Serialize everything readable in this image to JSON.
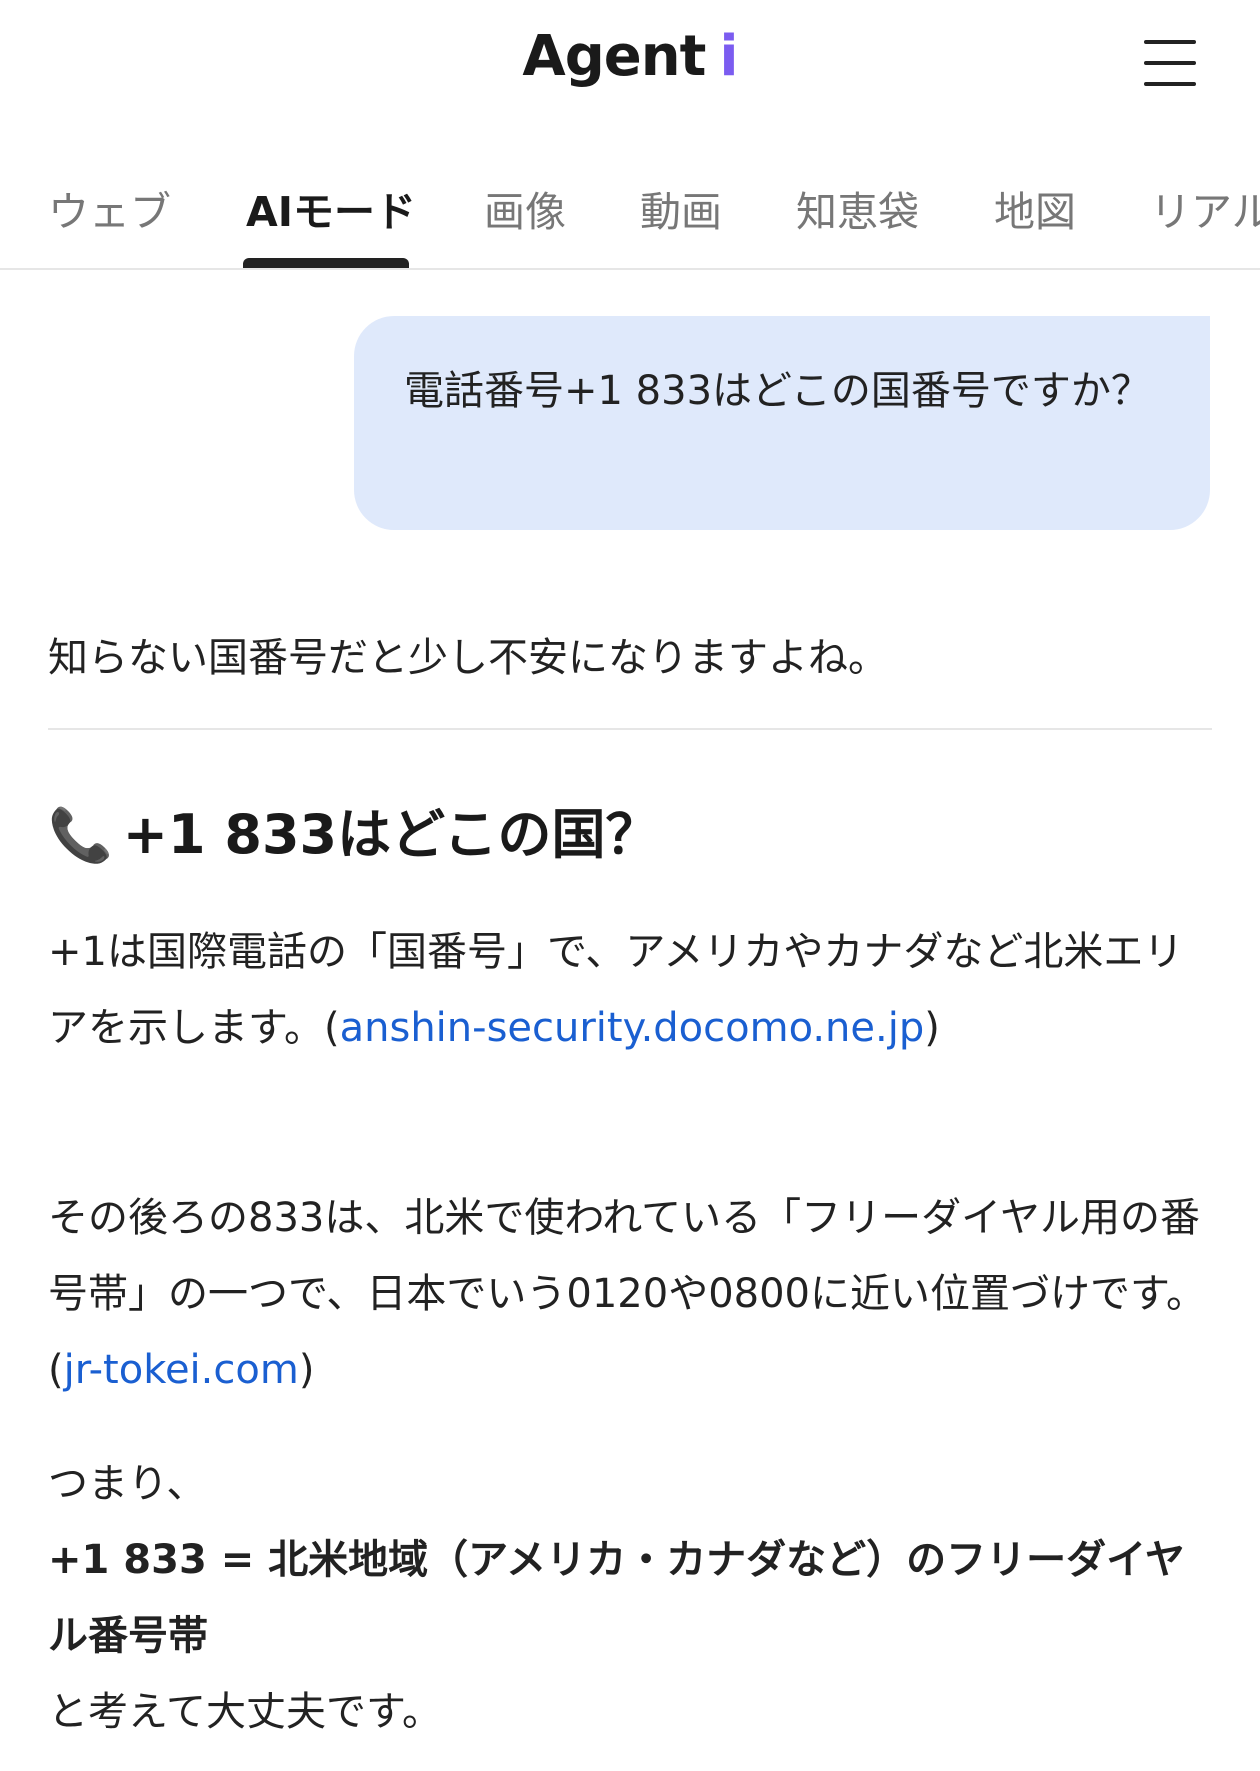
{
  "header": {
    "logo_text": "Agent",
    "logo_accent": "i",
    "menu_icon": "hamburger-icon"
  },
  "tabs": [
    {
      "label": "ウェブ"
    },
    {
      "label": "AIモード",
      "active": true
    },
    {
      "label": "画像"
    },
    {
      "label": "動画"
    },
    {
      "label": "知恵袋"
    },
    {
      "label": "地図"
    },
    {
      "label": "リアル"
    }
  ],
  "query": "電話番号+1 833はどこの国番号ですか？",
  "answer": {
    "intro": "知らない国番号だと少し不安になりますよね。",
    "heading_icon": "phone-icon",
    "heading": "+1 833はどこの国？",
    "p1_text": "+1は国際電話の「国番号」で、アメリカやカナダなど北米エリアを示します。",
    "p1_link": "anshin-security.docomo.ne.jp",
    "p2_text": "その後ろの833は、北米で使われている「フリーダイヤル用の番号帯」の一つで、日本でいう0120や0800に近い位置づけです。",
    "p2_link": "jr-tokei.com",
    "p3_lead": "つまり、",
    "p3_bold": "+1 833 = 北米地域（アメリカ・カナダなど）のフリーダイヤル番号帯",
    "p3_tail": "と考えて大丈夫です。"
  },
  "colors": {
    "accent": "#7b5cf0",
    "link": "#1a5fd1",
    "bubble": "#dfe9fb"
  }
}
